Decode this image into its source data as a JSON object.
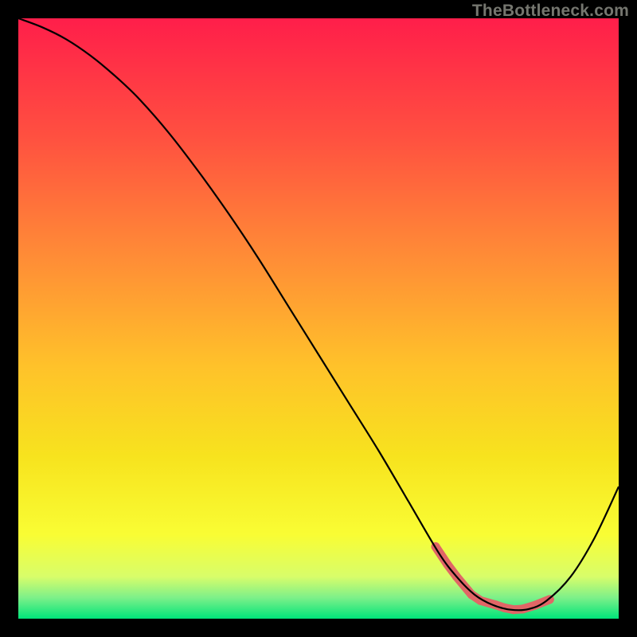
{
  "watermark": "TheBottleneck.com",
  "colors": {
    "frame": "#000000",
    "gradient_stops": [
      {
        "offset": 0.0,
        "color": "#ff1e4a"
      },
      {
        "offset": 0.2,
        "color": "#ff5140"
      },
      {
        "offset": 0.4,
        "color": "#ff8d36"
      },
      {
        "offset": 0.58,
        "color": "#ffc22a"
      },
      {
        "offset": 0.73,
        "color": "#f7e31e"
      },
      {
        "offset": 0.86,
        "color": "#f9fd34"
      },
      {
        "offset": 0.93,
        "color": "#d8fd6a"
      },
      {
        "offset": 0.965,
        "color": "#7df089"
      },
      {
        "offset": 1.0,
        "color": "#00e47a"
      }
    ],
    "curve": "#000000",
    "markers": "#e06666"
  },
  "chart_data": {
    "type": "line",
    "title": "",
    "xlabel": "",
    "ylabel": "",
    "xlim": [
      0,
      100
    ],
    "ylim": [
      0,
      100
    ],
    "series": [
      {
        "name": "bottleneck-curve",
        "x": [
          0,
          4,
          8,
          12,
          16,
          20,
          25,
          30,
          35,
          40,
          45,
          50,
          55,
          60,
          65,
          70,
          73,
          76,
          79,
          82,
          85,
          88,
          92,
          96,
          100
        ],
        "y": [
          100,
          98.5,
          96.5,
          93.8,
          90.5,
          86.7,
          81,
          74.5,
          67.5,
          60,
          52,
          44,
          36,
          28,
          19.5,
          11,
          7,
          4,
          2.3,
          1.5,
          1.6,
          3,
          7,
          13.5,
          22
        ]
      }
    ],
    "markers": {
      "name": "highlight-band",
      "x": [
        69.5,
        71.5,
        73.0,
        75.5,
        77.0,
        79.5,
        81.0,
        82.5,
        84.0,
        86.0,
        88.5
      ],
      "y": [
        12.0,
        9.0,
        7.0,
        4.0,
        3.0,
        2.3,
        1.8,
        1.5,
        1.6,
        2.2,
        3.2
      ]
    }
  }
}
